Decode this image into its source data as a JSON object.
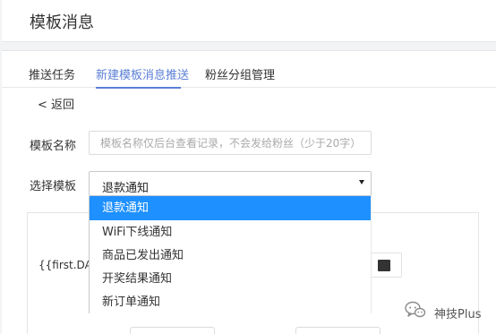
{
  "page": {
    "title": "模板消息"
  },
  "tabs": [
    {
      "label": "推送任务",
      "active": false
    },
    {
      "label": "新建模板消息推送",
      "active": true
    },
    {
      "label": "粉丝分组管理",
      "active": false
    }
  ],
  "back": {
    "label": "< 返回"
  },
  "form": {
    "name_label": "模板名称",
    "name_placeholder": "模板名称仅后台查看记录，不会发给粉丝（少于20字）",
    "template_label": "选择模板",
    "template_value": "退款通知"
  },
  "dropdown": {
    "options": [
      {
        "label": "退款通知",
        "selected": true
      },
      {
        "label": "WiFi下线通知",
        "selected": false
      },
      {
        "label": "商品已发出通知",
        "selected": false
      },
      {
        "label": "开奖结果通知",
        "selected": false
      },
      {
        "label": "新订单通知",
        "selected": false
      }
    ]
  },
  "content": {
    "variable_text": "{{first.DATA",
    "color_value": "#333333"
  },
  "watermark": {
    "text": "神技Plus",
    "icon": "wechat-icon"
  },
  "colors": {
    "accent": "#5b7fd6",
    "selected": "#1e90ff"
  }
}
